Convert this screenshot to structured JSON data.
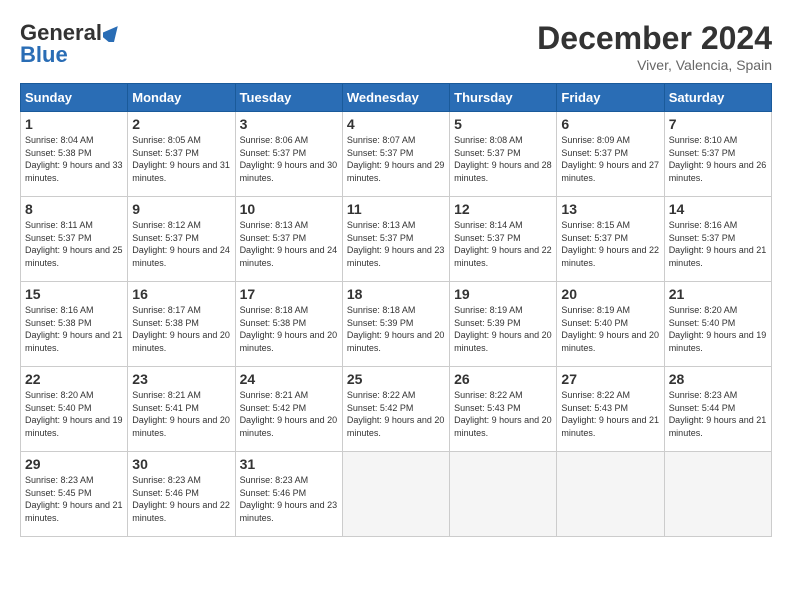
{
  "header": {
    "logo_general": "General",
    "logo_blue": "Blue",
    "month": "December 2024",
    "location": "Viver, Valencia, Spain"
  },
  "weekdays": [
    "Sunday",
    "Monday",
    "Tuesday",
    "Wednesday",
    "Thursday",
    "Friday",
    "Saturday"
  ],
  "weeks": [
    [
      {
        "day": "1",
        "sunrise": "Sunrise: 8:04 AM",
        "sunset": "Sunset: 5:38 PM",
        "daylight": "Daylight: 9 hours and 33 minutes."
      },
      {
        "day": "2",
        "sunrise": "Sunrise: 8:05 AM",
        "sunset": "Sunset: 5:37 PM",
        "daylight": "Daylight: 9 hours and 31 minutes."
      },
      {
        "day": "3",
        "sunrise": "Sunrise: 8:06 AM",
        "sunset": "Sunset: 5:37 PM",
        "daylight": "Daylight: 9 hours and 30 minutes."
      },
      {
        "day": "4",
        "sunrise": "Sunrise: 8:07 AM",
        "sunset": "Sunset: 5:37 PM",
        "daylight": "Daylight: 9 hours and 29 minutes."
      },
      {
        "day": "5",
        "sunrise": "Sunrise: 8:08 AM",
        "sunset": "Sunset: 5:37 PM",
        "daylight": "Daylight: 9 hours and 28 minutes."
      },
      {
        "day": "6",
        "sunrise": "Sunrise: 8:09 AM",
        "sunset": "Sunset: 5:37 PM",
        "daylight": "Daylight: 9 hours and 27 minutes."
      },
      {
        "day": "7",
        "sunrise": "Sunrise: 8:10 AM",
        "sunset": "Sunset: 5:37 PM",
        "daylight": "Daylight: 9 hours and 26 minutes."
      }
    ],
    [
      {
        "day": "8",
        "sunrise": "Sunrise: 8:11 AM",
        "sunset": "Sunset: 5:37 PM",
        "daylight": "Daylight: 9 hours and 25 minutes."
      },
      {
        "day": "9",
        "sunrise": "Sunrise: 8:12 AM",
        "sunset": "Sunset: 5:37 PM",
        "daylight": "Daylight: 9 hours and 24 minutes."
      },
      {
        "day": "10",
        "sunrise": "Sunrise: 8:13 AM",
        "sunset": "Sunset: 5:37 PM",
        "daylight": "Daylight: 9 hours and 24 minutes."
      },
      {
        "day": "11",
        "sunrise": "Sunrise: 8:13 AM",
        "sunset": "Sunset: 5:37 PM",
        "daylight": "Daylight: 9 hours and 23 minutes."
      },
      {
        "day": "12",
        "sunrise": "Sunrise: 8:14 AM",
        "sunset": "Sunset: 5:37 PM",
        "daylight": "Daylight: 9 hours and 22 minutes."
      },
      {
        "day": "13",
        "sunrise": "Sunrise: 8:15 AM",
        "sunset": "Sunset: 5:37 PM",
        "daylight": "Daylight: 9 hours and 22 minutes."
      },
      {
        "day": "14",
        "sunrise": "Sunrise: 8:16 AM",
        "sunset": "Sunset: 5:37 PM",
        "daylight": "Daylight: 9 hours and 21 minutes."
      }
    ],
    [
      {
        "day": "15",
        "sunrise": "Sunrise: 8:16 AM",
        "sunset": "Sunset: 5:38 PM",
        "daylight": "Daylight: 9 hours and 21 minutes."
      },
      {
        "day": "16",
        "sunrise": "Sunrise: 8:17 AM",
        "sunset": "Sunset: 5:38 PM",
        "daylight": "Daylight: 9 hours and 20 minutes."
      },
      {
        "day": "17",
        "sunrise": "Sunrise: 8:18 AM",
        "sunset": "Sunset: 5:38 PM",
        "daylight": "Daylight: 9 hours and 20 minutes."
      },
      {
        "day": "18",
        "sunrise": "Sunrise: 8:18 AM",
        "sunset": "Sunset: 5:39 PM",
        "daylight": "Daylight: 9 hours and 20 minutes."
      },
      {
        "day": "19",
        "sunrise": "Sunrise: 8:19 AM",
        "sunset": "Sunset: 5:39 PM",
        "daylight": "Daylight: 9 hours and 20 minutes."
      },
      {
        "day": "20",
        "sunrise": "Sunrise: 8:19 AM",
        "sunset": "Sunset: 5:40 PM",
        "daylight": "Daylight: 9 hours and 20 minutes."
      },
      {
        "day": "21",
        "sunrise": "Sunrise: 8:20 AM",
        "sunset": "Sunset: 5:40 PM",
        "daylight": "Daylight: 9 hours and 19 minutes."
      }
    ],
    [
      {
        "day": "22",
        "sunrise": "Sunrise: 8:20 AM",
        "sunset": "Sunset: 5:40 PM",
        "daylight": "Daylight: 9 hours and 19 minutes."
      },
      {
        "day": "23",
        "sunrise": "Sunrise: 8:21 AM",
        "sunset": "Sunset: 5:41 PM",
        "daylight": "Daylight: 9 hours and 20 minutes."
      },
      {
        "day": "24",
        "sunrise": "Sunrise: 8:21 AM",
        "sunset": "Sunset: 5:42 PM",
        "daylight": "Daylight: 9 hours and 20 minutes."
      },
      {
        "day": "25",
        "sunrise": "Sunrise: 8:22 AM",
        "sunset": "Sunset: 5:42 PM",
        "daylight": "Daylight: 9 hours and 20 minutes."
      },
      {
        "day": "26",
        "sunrise": "Sunrise: 8:22 AM",
        "sunset": "Sunset: 5:43 PM",
        "daylight": "Daylight: 9 hours and 20 minutes."
      },
      {
        "day": "27",
        "sunrise": "Sunrise: 8:22 AM",
        "sunset": "Sunset: 5:43 PM",
        "daylight": "Daylight: 9 hours and 21 minutes."
      },
      {
        "day": "28",
        "sunrise": "Sunrise: 8:23 AM",
        "sunset": "Sunset: 5:44 PM",
        "daylight": "Daylight: 9 hours and 21 minutes."
      }
    ],
    [
      {
        "day": "29",
        "sunrise": "Sunrise: 8:23 AM",
        "sunset": "Sunset: 5:45 PM",
        "daylight": "Daylight: 9 hours and 21 minutes."
      },
      {
        "day": "30",
        "sunrise": "Sunrise: 8:23 AM",
        "sunset": "Sunset: 5:46 PM",
        "daylight": "Daylight: 9 hours and 22 minutes."
      },
      {
        "day": "31",
        "sunrise": "Sunrise: 8:23 AM",
        "sunset": "Sunset: 5:46 PM",
        "daylight": "Daylight: 9 hours and 23 minutes."
      },
      null,
      null,
      null,
      null
    ]
  ]
}
